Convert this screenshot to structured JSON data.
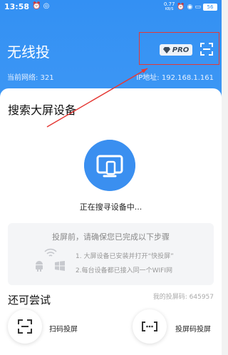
{
  "status_bar": {
    "time": "13:58",
    "speed": "0.77",
    "speed_unit": "KB/S",
    "battery": "56"
  },
  "header": {
    "title": "无线投",
    "pro_label": "PRO",
    "current_network": "当前网络: 321",
    "ip_address": "IP地址: 192.168.1.161"
  },
  "main": {
    "search_title": "搜索大屏设备",
    "searching_text": "正在搜寻设备中...",
    "steps": {
      "heading": "投屏前，请确保您已完成以下步骤",
      "step1": "1. 大屏设备已安装并打开“快投屏”",
      "step2": "2.每台设备都已接入同一个WIFI网"
    }
  },
  "bottom": {
    "try_title": "还可尝试",
    "my_code": "我的投屏码: 645957",
    "scan_label": "扫码投屏",
    "code_label": "投屏码投屏"
  },
  "colors": {
    "primary": "#3390f3",
    "highlight": "#e53935"
  }
}
